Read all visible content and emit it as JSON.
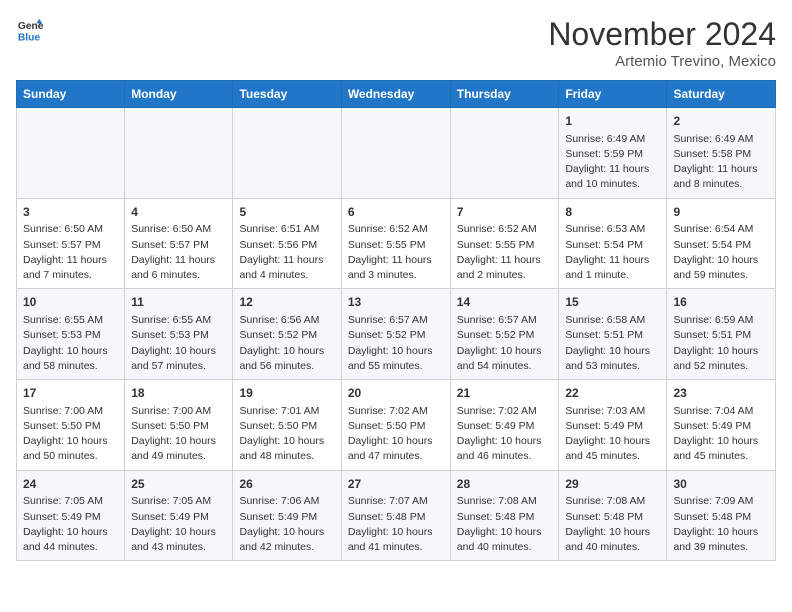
{
  "header": {
    "logo_line1": "General",
    "logo_line2": "Blue",
    "month": "November 2024",
    "location": "Artemio Trevino, Mexico"
  },
  "weekdays": [
    "Sunday",
    "Monday",
    "Tuesday",
    "Wednesday",
    "Thursday",
    "Friday",
    "Saturday"
  ],
  "rows": [
    [
      {
        "day": "",
        "info": ""
      },
      {
        "day": "",
        "info": ""
      },
      {
        "day": "",
        "info": ""
      },
      {
        "day": "",
        "info": ""
      },
      {
        "day": "",
        "info": ""
      },
      {
        "day": "1",
        "info": "Sunrise: 6:49 AM\nSunset: 5:59 PM\nDaylight: 11 hours and 10 minutes."
      },
      {
        "day": "2",
        "info": "Sunrise: 6:49 AM\nSunset: 5:58 PM\nDaylight: 11 hours and 8 minutes."
      }
    ],
    [
      {
        "day": "3",
        "info": "Sunrise: 6:50 AM\nSunset: 5:57 PM\nDaylight: 11 hours and 7 minutes."
      },
      {
        "day": "4",
        "info": "Sunrise: 6:50 AM\nSunset: 5:57 PM\nDaylight: 11 hours and 6 minutes."
      },
      {
        "day": "5",
        "info": "Sunrise: 6:51 AM\nSunset: 5:56 PM\nDaylight: 11 hours and 4 minutes."
      },
      {
        "day": "6",
        "info": "Sunrise: 6:52 AM\nSunset: 5:55 PM\nDaylight: 11 hours and 3 minutes."
      },
      {
        "day": "7",
        "info": "Sunrise: 6:52 AM\nSunset: 5:55 PM\nDaylight: 11 hours and 2 minutes."
      },
      {
        "day": "8",
        "info": "Sunrise: 6:53 AM\nSunset: 5:54 PM\nDaylight: 11 hours and 1 minute."
      },
      {
        "day": "9",
        "info": "Sunrise: 6:54 AM\nSunset: 5:54 PM\nDaylight: 10 hours and 59 minutes."
      }
    ],
    [
      {
        "day": "10",
        "info": "Sunrise: 6:55 AM\nSunset: 5:53 PM\nDaylight: 10 hours and 58 minutes."
      },
      {
        "day": "11",
        "info": "Sunrise: 6:55 AM\nSunset: 5:53 PM\nDaylight: 10 hours and 57 minutes."
      },
      {
        "day": "12",
        "info": "Sunrise: 6:56 AM\nSunset: 5:52 PM\nDaylight: 10 hours and 56 minutes."
      },
      {
        "day": "13",
        "info": "Sunrise: 6:57 AM\nSunset: 5:52 PM\nDaylight: 10 hours and 55 minutes."
      },
      {
        "day": "14",
        "info": "Sunrise: 6:57 AM\nSunset: 5:52 PM\nDaylight: 10 hours and 54 minutes."
      },
      {
        "day": "15",
        "info": "Sunrise: 6:58 AM\nSunset: 5:51 PM\nDaylight: 10 hours and 53 minutes."
      },
      {
        "day": "16",
        "info": "Sunrise: 6:59 AM\nSunset: 5:51 PM\nDaylight: 10 hours and 52 minutes."
      }
    ],
    [
      {
        "day": "17",
        "info": "Sunrise: 7:00 AM\nSunset: 5:50 PM\nDaylight: 10 hours and 50 minutes."
      },
      {
        "day": "18",
        "info": "Sunrise: 7:00 AM\nSunset: 5:50 PM\nDaylight: 10 hours and 49 minutes."
      },
      {
        "day": "19",
        "info": "Sunrise: 7:01 AM\nSunset: 5:50 PM\nDaylight: 10 hours and 48 minutes."
      },
      {
        "day": "20",
        "info": "Sunrise: 7:02 AM\nSunset: 5:50 PM\nDaylight: 10 hours and 47 minutes."
      },
      {
        "day": "21",
        "info": "Sunrise: 7:02 AM\nSunset: 5:49 PM\nDaylight: 10 hours and 46 minutes."
      },
      {
        "day": "22",
        "info": "Sunrise: 7:03 AM\nSunset: 5:49 PM\nDaylight: 10 hours and 45 minutes."
      },
      {
        "day": "23",
        "info": "Sunrise: 7:04 AM\nSunset: 5:49 PM\nDaylight: 10 hours and 45 minutes."
      }
    ],
    [
      {
        "day": "24",
        "info": "Sunrise: 7:05 AM\nSunset: 5:49 PM\nDaylight: 10 hours and 44 minutes."
      },
      {
        "day": "25",
        "info": "Sunrise: 7:05 AM\nSunset: 5:49 PM\nDaylight: 10 hours and 43 minutes."
      },
      {
        "day": "26",
        "info": "Sunrise: 7:06 AM\nSunset: 5:49 PM\nDaylight: 10 hours and 42 minutes."
      },
      {
        "day": "27",
        "info": "Sunrise: 7:07 AM\nSunset: 5:48 PM\nDaylight: 10 hours and 41 minutes."
      },
      {
        "day": "28",
        "info": "Sunrise: 7:08 AM\nSunset: 5:48 PM\nDaylight: 10 hours and 40 minutes."
      },
      {
        "day": "29",
        "info": "Sunrise: 7:08 AM\nSunset: 5:48 PM\nDaylight: 10 hours and 40 minutes."
      },
      {
        "day": "30",
        "info": "Sunrise: 7:09 AM\nSunset: 5:48 PM\nDaylight: 10 hours and 39 minutes."
      }
    ]
  ]
}
